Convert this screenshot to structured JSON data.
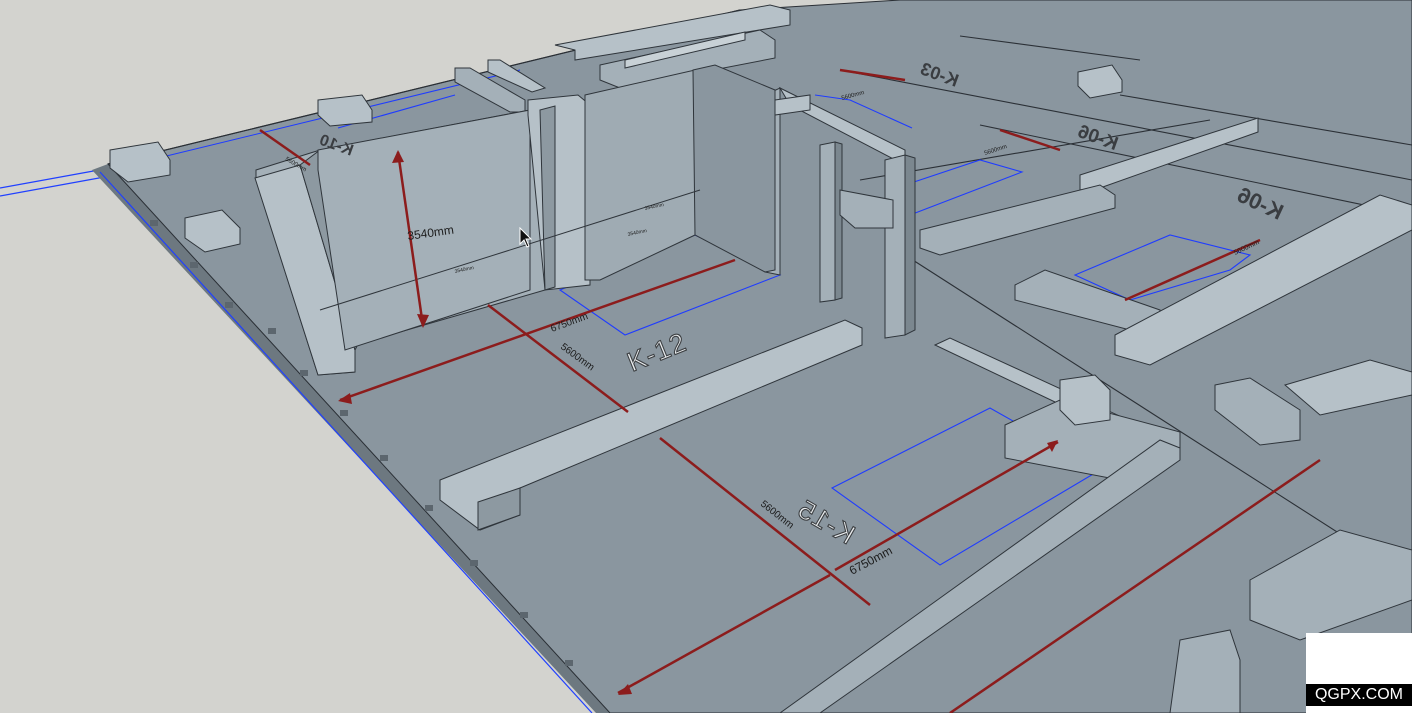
{
  "viewport": {
    "colors": {
      "background": "#d3d3cf",
      "floor": "#8a969f",
      "wall_top": "#b6c1c8",
      "wall_light": "#a4b0b8",
      "wall_dark": "#7b878f",
      "dimension_line": "#8c1c1c",
      "room_outline": "#1f3cff",
      "axis_red": "#d81e1e"
    }
  },
  "dimensions": [
    {
      "id": "wall-height",
      "text": "3540mm"
    },
    {
      "id": "k12-width",
      "text": "6750mm"
    },
    {
      "id": "k12-depth",
      "text": "5600mm"
    },
    {
      "id": "k15-depth",
      "text": "5600mm"
    },
    {
      "id": "k15-width",
      "text": "6750mm"
    },
    {
      "id": "small-a",
      "text": "3540mm"
    },
    {
      "id": "small-b",
      "text": "3540mm"
    },
    {
      "id": "small-c",
      "text": "3540mm"
    },
    {
      "id": "small-d",
      "text": "5600mm"
    },
    {
      "id": "small-e",
      "text": "5600mm"
    },
    {
      "id": "small-f",
      "text": "5600mm"
    },
    {
      "id": "small-g",
      "text": "5600mm"
    }
  ],
  "rooms": [
    {
      "id": "k12",
      "label": "K-12"
    },
    {
      "id": "k15",
      "label": "K-15"
    },
    {
      "id": "k03",
      "label": "K-03"
    },
    {
      "id": "k06a",
      "label": "K-06"
    },
    {
      "id": "k06b",
      "label": "K-06"
    },
    {
      "id": "k10",
      "label": "K-10"
    }
  ],
  "watermark": {
    "text": "QGPX.COM"
  },
  "cursor": {
    "icon": "arrow-cursor-icon"
  }
}
